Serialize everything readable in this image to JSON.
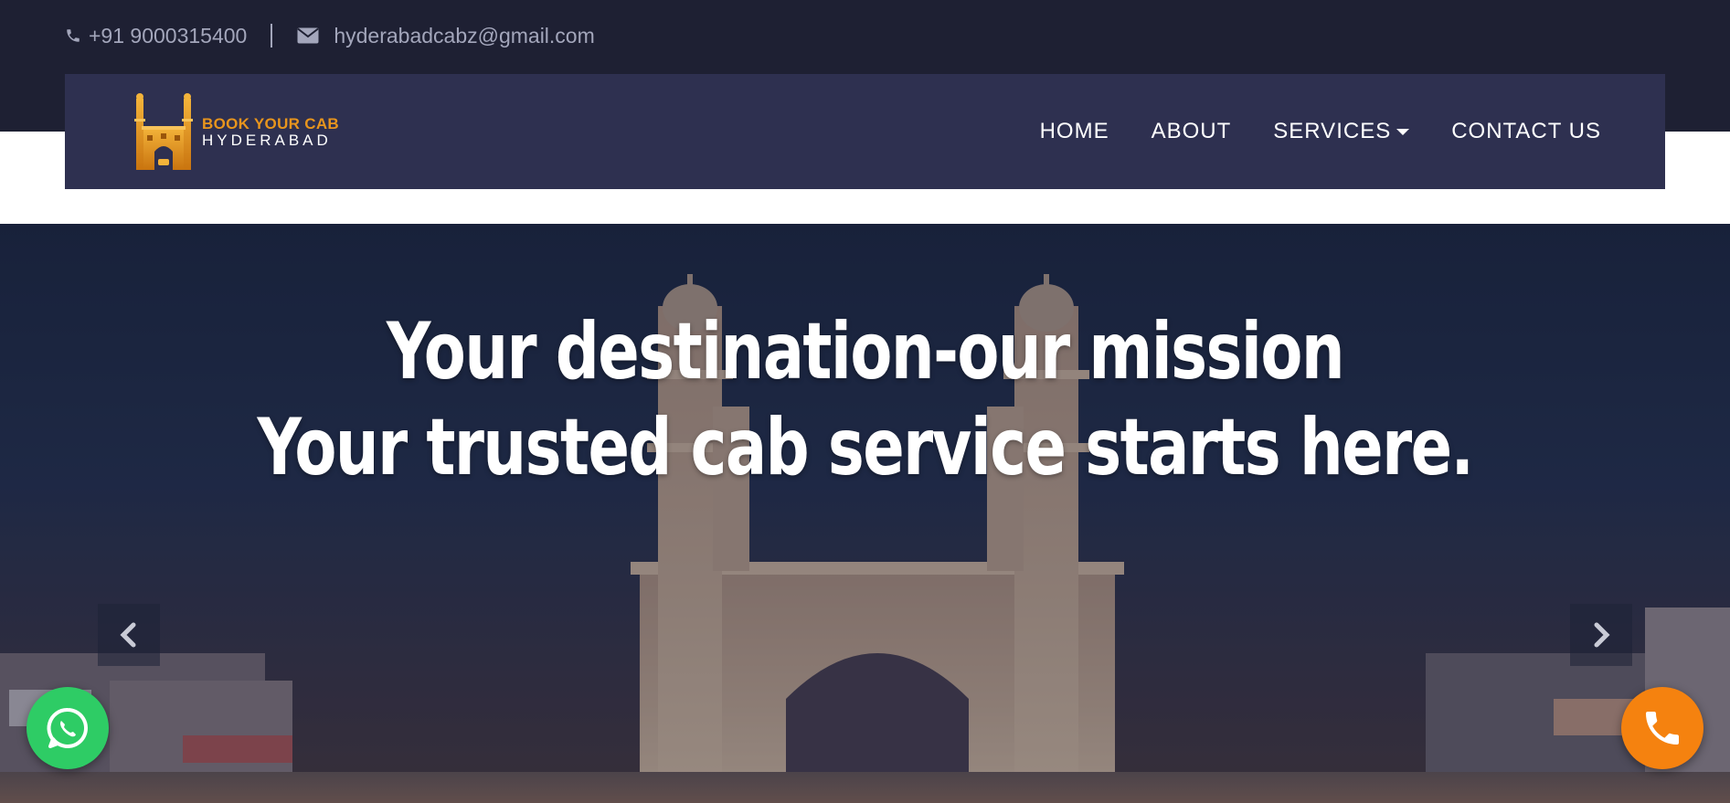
{
  "topbar": {
    "phone": "+91 9000315400",
    "email": "hyderabadcabz@gmail.com"
  },
  "logo": {
    "line1": "BOOK YOUR CAB",
    "line2": "HYDERABAD"
  },
  "nav": {
    "items": [
      {
        "label": "HOME"
      },
      {
        "label": "ABOUT"
      },
      {
        "label": "SERVICES"
      },
      {
        "label": "CONTACT US"
      }
    ]
  },
  "hero": {
    "line1": "Your destination-our mission",
    "line2": "Your trusted cab service starts here."
  },
  "colors": {
    "topbar_bg": "#1e2033",
    "navbar_bg": "#2e3050",
    "logo_accent": "#e8951d",
    "whatsapp": "#2ecc65",
    "call": "#f5820f"
  },
  "icons": {
    "phone": "phone-icon",
    "email": "envelope-icon",
    "prev": "chevron-left-icon",
    "next": "chevron-right-icon",
    "whatsapp": "whatsapp-icon",
    "call": "phone-call-icon"
  }
}
